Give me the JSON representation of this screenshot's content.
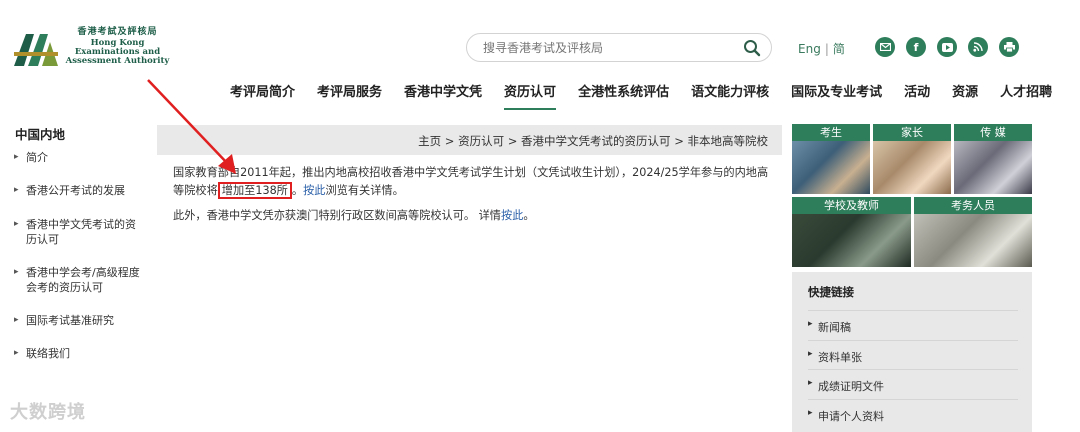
{
  "header": {
    "logo_cn": "香港考試及評核局",
    "logo_en_1": "Hong Kong",
    "logo_en_2": "Examinations and",
    "logo_en_3": "Assessment Authority",
    "search_placeholder": "搜寻香港考试及评核局",
    "lang_en": "Eng",
    "lang_sc": "简"
  },
  "nav": {
    "items": [
      "考评局简介",
      "考评局服务",
      "香港中学文凭",
      "资历认可",
      "全港性系统评估",
      "语文能力评核",
      "国际及专业考试",
      "活动",
      "资源",
      "人才招聘"
    ]
  },
  "sidebar": {
    "title": "中国内地",
    "items": [
      "简介",
      "香港公开考试的发展",
      "香港中学文凭考试的资历认可",
      "香港中学会考/高级程度会考的资历认可",
      "国际考试基准研究",
      "联络我们"
    ]
  },
  "breadcrumb": "主页 > 资历认可 > 香港中学文凭考试的资历认可 > 非本地高等院校",
  "content": {
    "p1_a": "国家教育部自2011年起，推出内地高校招收香港中学文凭考试学生计划（文凭试收生计划），2024/25学年参与的内地高等院校将",
    "p1_highlight": "增加至138所",
    "p1_b": "。",
    "p1_link": "按此",
    "p1_c": "浏览有关详情。",
    "p2_a": "此外，香港中学文凭亦获澳门特别行政区数间高等院校认可。 详情",
    "p2_link": "按此",
    "p2_b": "。"
  },
  "tiles": [
    "考生",
    "家长",
    "传 媒",
    "学校及教师",
    "考务人员"
  ],
  "quick_links": {
    "title": "快捷链接",
    "items": [
      "新闻稿",
      "资料单张",
      "成绩证明文件",
      "申请个人资料"
    ]
  },
  "watermark": "大数跨境",
  "colors": {
    "brand": "#2e7d5b",
    "highlight": "#e02020",
    "link": "#2a5fa8"
  }
}
